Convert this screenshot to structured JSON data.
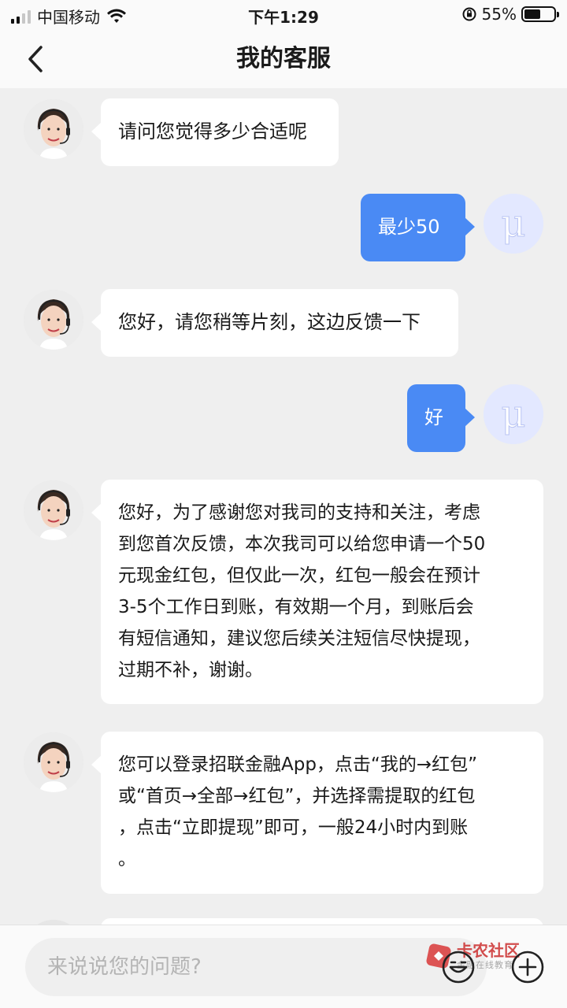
{
  "status_bar": {
    "carrier": "中国移动",
    "time": "下午1:29",
    "battery_percent": "55%",
    "battery_level": 0.55,
    "icons": [
      "signal-icon",
      "wifi-icon",
      "rotation-lock-icon",
      "battery-icon"
    ]
  },
  "header": {
    "title": "我的客服",
    "back_icon": "chevron-left-icon"
  },
  "messages": [
    {
      "from": "agent",
      "text": "请问您觉得多少合适呢"
    },
    {
      "from": "user",
      "text": "最少50"
    },
    {
      "from": "agent",
      "text": "您好，请您稍等片刻，这边反馈一下"
    },
    {
      "from": "user",
      "text": "好"
    },
    {
      "from": "agent",
      "lines": [
        "您好，为了感谢您对我司的支持和关注，考虑",
        "到您首次反馈，本次我司可以给您申请一个50",
        "元现金红包，但仅此一次，红包一般会在预计",
        "3-5个工作日到账，有效期一个月，到账后会",
        "有短信通知，建议您后续关注短信尽快提现，",
        "过期不补，谢谢。"
      ]
    },
    {
      "from": "agent",
      "lines": [
        "您可以登录招联金融App，点击“我的→红包”",
        "或“首页→全部→红包”，并选择需提取的红包",
        "，点击“立即提现”即可，一般24小时内到账",
        "。"
      ]
    }
  ],
  "user_avatar_glyph": "μ",
  "input": {
    "placeholder": "来说说您的问题?",
    "emoji_icon": "emoji-icon",
    "plus_icon": "plus-icon"
  },
  "watermark": {
    "title": "卡农社区",
    "subtitle": "金融在线教育"
  },
  "colors": {
    "accent": "#4a8af4",
    "background": "#efefef",
    "bubble_incoming": "#ffffff"
  }
}
